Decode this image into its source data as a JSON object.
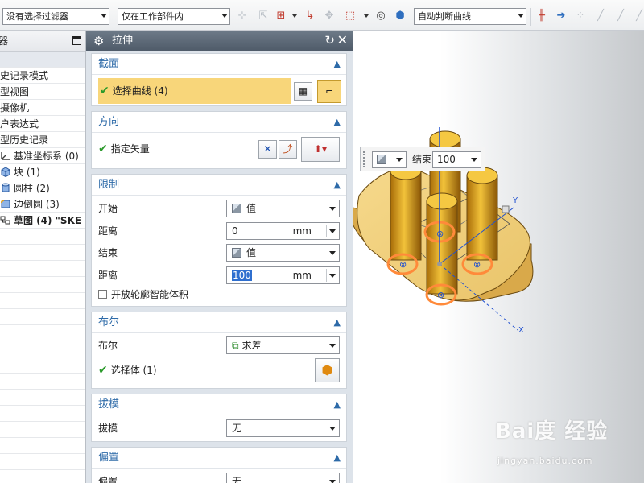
{
  "toolbar": {
    "filter_combo": "没有选择过滤器",
    "scope_combo": "仅在工作部件内",
    "curve_rule_combo": "自动判断曲线"
  },
  "navigator": {
    "title": "器",
    "rows": [
      {
        "label": "",
        "selected": true
      },
      {
        "label": "史记录模式"
      },
      {
        "label": "型视图"
      },
      {
        "label": "摄像机"
      },
      {
        "label": "户表达式"
      },
      {
        "label": "型历史记录"
      },
      {
        "label": "基准坐标系 (0)",
        "icon": "datum-csys-icon"
      },
      {
        "label": "块 (1)",
        "icon": "block-icon"
      },
      {
        "label": "圆柱 (2)",
        "icon": "cylinder-icon"
      },
      {
        "label": "边倒圆 (3)",
        "icon": "edge-blend-icon"
      },
      {
        "label": "草图 (4) \"SKE",
        "icon": "sketch-icon",
        "bold": true
      }
    ]
  },
  "dialog": {
    "title": "拉伸",
    "section": {
      "title": "截面",
      "select_curve": "选择曲线 (4)"
    },
    "direction": {
      "title": "方向",
      "specify_vector": "指定矢量"
    },
    "limits": {
      "title": "限制",
      "start_label": "开始",
      "start_value": "值",
      "start_distance_label": "距离",
      "start_distance": "0",
      "unit": "mm",
      "end_label": "结束",
      "end_value": "值",
      "end_distance_label": "距离",
      "end_distance": "100",
      "open_profile": "开放轮廓智能体积"
    },
    "boolean": {
      "title": "布尔",
      "label": "布尔",
      "value": "求差",
      "select_body": "选择体 (1)"
    },
    "draft": {
      "title": "拔模",
      "label": "拔模",
      "value": "无"
    },
    "offset": {
      "title": "偏置",
      "label": "偏置",
      "value": "无"
    }
  },
  "viewport": {
    "float_label": "结束",
    "float_value": "100",
    "axis_y": "Y",
    "axis_x": "X",
    "watermark": "Bai度 经验",
    "watermark_url": "jingyan.baidu.com"
  }
}
